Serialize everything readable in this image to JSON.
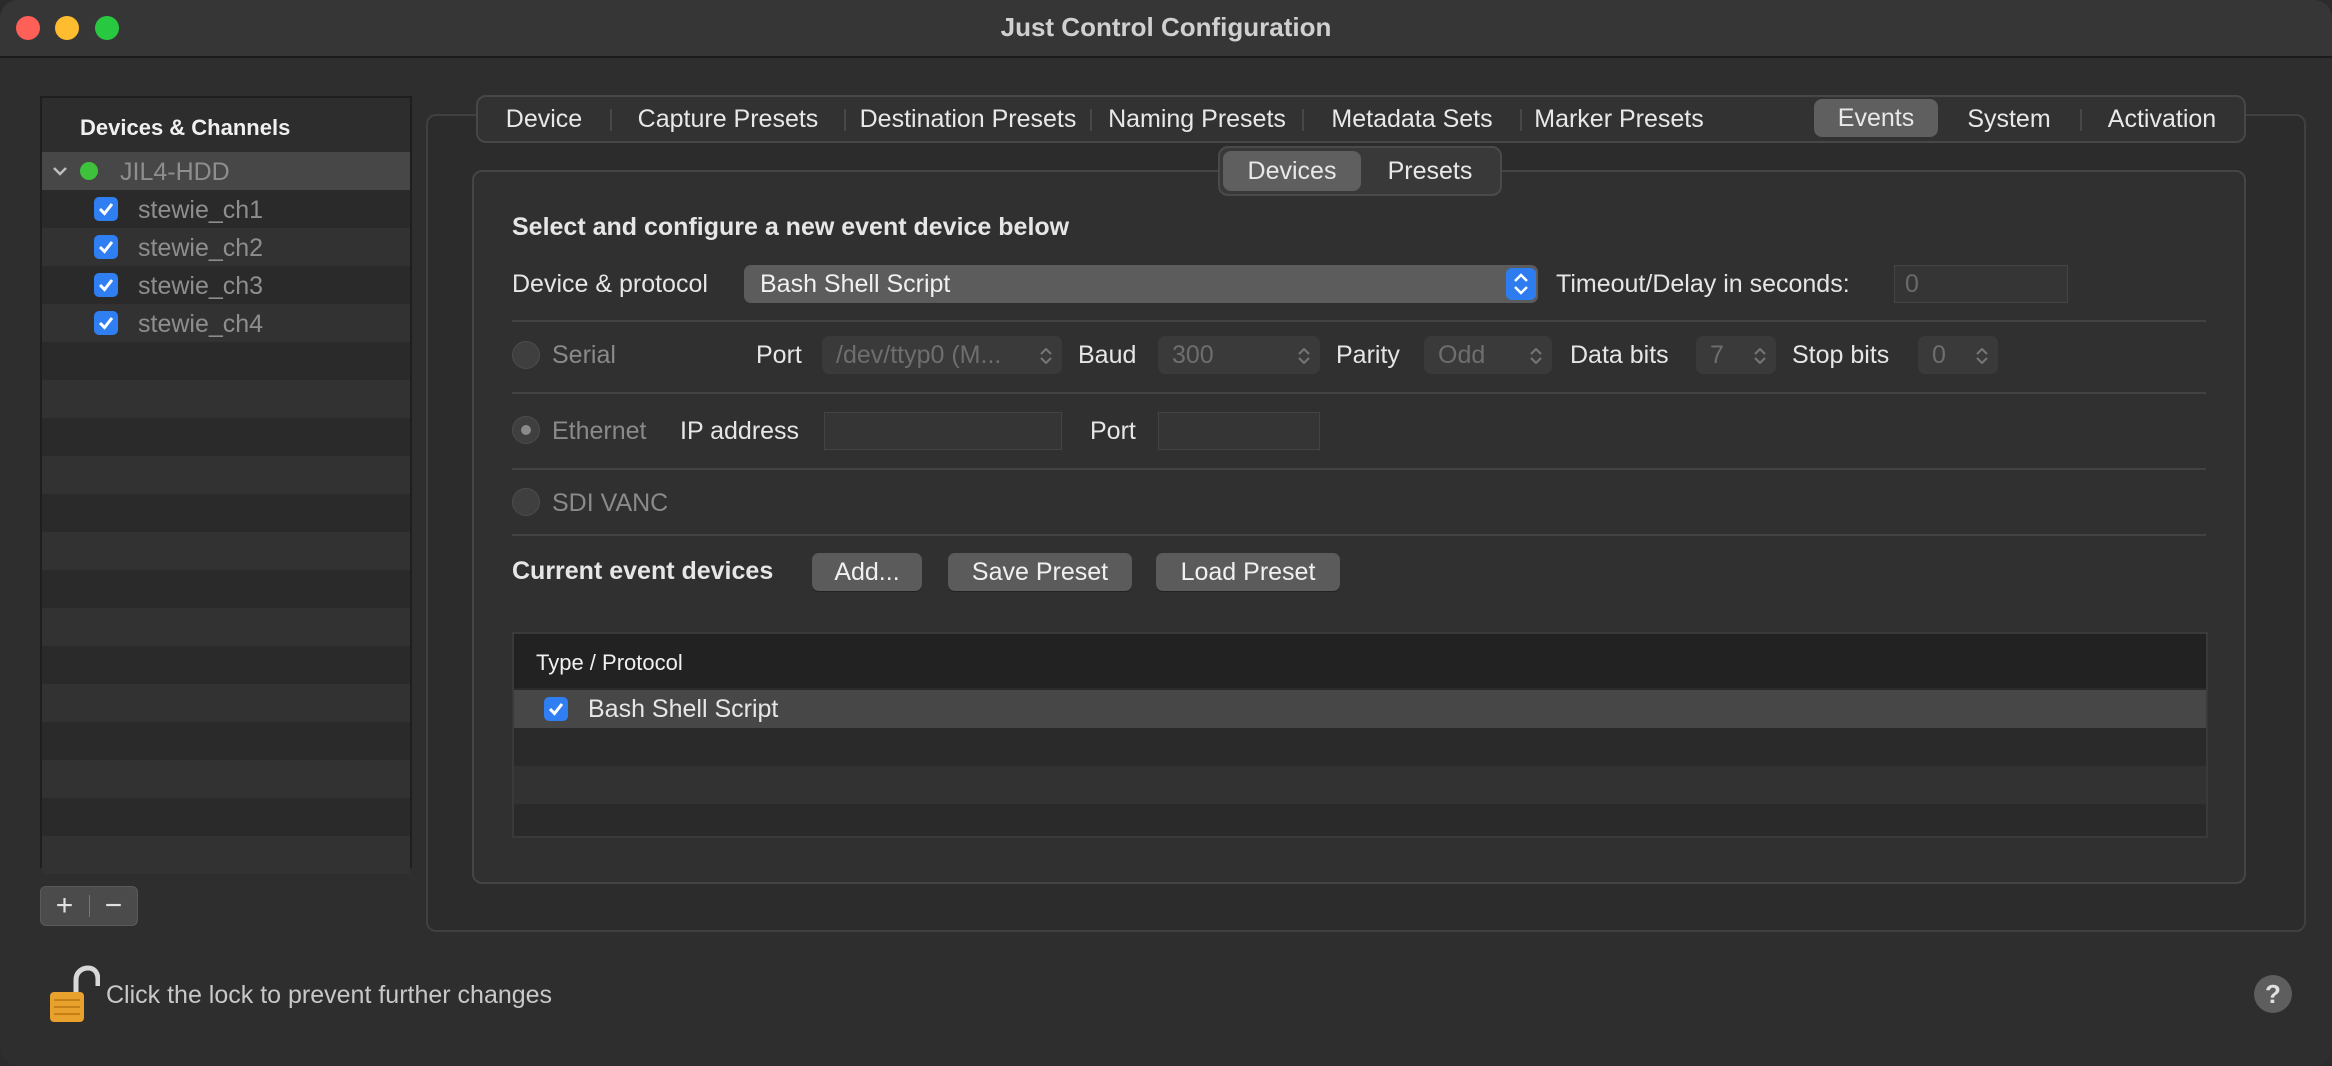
{
  "window": {
    "title": "Just Control Configuration"
  },
  "sidebar": {
    "header": "Devices & Channels",
    "device": {
      "name": "JIL4-HDD",
      "status_color": "#3ec23c",
      "expanded": true
    },
    "channels": [
      {
        "label": "stewie_ch1",
        "checked": true
      },
      {
        "label": "stewie_ch2",
        "checked": true
      },
      {
        "label": "stewie_ch3",
        "checked": true
      },
      {
        "label": "stewie_ch4",
        "checked": true
      }
    ],
    "add_label": "+",
    "remove_label": "−"
  },
  "tabs": {
    "items": [
      "Device",
      "Capture Presets",
      "Destination Presets",
      "Naming Presets",
      "Metadata Sets",
      "Marker Presets",
      "Events",
      "System",
      "Activation"
    ],
    "active": "Events"
  },
  "subtabs": {
    "items": [
      "Devices",
      "Presets"
    ],
    "active": "Devices"
  },
  "events": {
    "heading": "Select and configure a new event device below",
    "device_protocol_label": "Device & protocol",
    "device_protocol_value": "Bash Shell Script",
    "timeout_label": "Timeout/Delay in seconds:",
    "timeout_placeholder": "0",
    "serial": {
      "label": "Serial",
      "port_label": "Port",
      "port_value": "/dev/ttyp0 (M...",
      "baud_label": "Baud",
      "baud_value": "300",
      "parity_label": "Parity",
      "parity_value": "Odd",
      "databits_label": "Data bits",
      "databits_value": "7",
      "stopbits_label": "Stop bits",
      "stopbits_value": "0"
    },
    "ethernet": {
      "label": "Ethernet",
      "ip_label": "IP address",
      "port_label": "Port",
      "selected": true
    },
    "sdi": {
      "label": "SDI VANC"
    },
    "current_label": "Current event devices",
    "add_button": "Add...",
    "save_button": "Save Preset",
    "load_button": "Load Preset",
    "table": {
      "column": "Type / Protocol",
      "rows": [
        {
          "label": "Bash Shell Script",
          "checked": true
        }
      ]
    }
  },
  "footer": {
    "lock_text": "Click the lock to prevent further changes",
    "help_label": "?"
  },
  "colors": {
    "accent": "#2f7ff2",
    "lock": "#e8a12c"
  }
}
